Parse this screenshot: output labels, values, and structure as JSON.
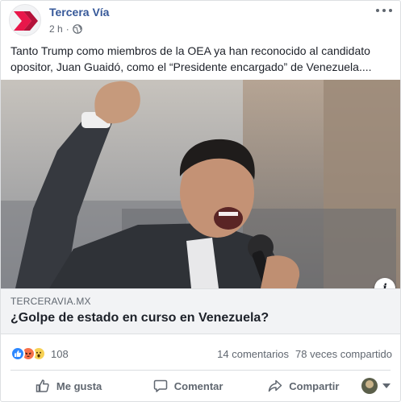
{
  "post": {
    "page_name": "Tercera Vía",
    "timestamp": "2 h",
    "separator": "·",
    "text": "Tanto Trump como miembros de la OEA ya han reconocido al candidato opositor, Juan Guaidó, como el “Presidente encargado” de Venezuela....",
    "icons": {
      "logo": "tercera-via-logo",
      "privacy": "globe-icon",
      "menu": "more-options-icon"
    }
  },
  "link": {
    "domain": "TERCERAVIA.MX",
    "headline": "¿Golpe de estado en curso en Venezuela?",
    "info_label": "i"
  },
  "stats": {
    "reaction_count": "108",
    "reactions": [
      "like",
      "angry",
      "wow"
    ],
    "comments": "14 comentarios",
    "shares": "78 veces compartido"
  },
  "actions": {
    "like": "Me gusta",
    "comment": "Comentar",
    "share": "Compartir"
  },
  "colors": {
    "brand_red": "#e8174a",
    "link_blue": "#365899",
    "like_blue": "#2d88ff",
    "muted": "#606770"
  }
}
